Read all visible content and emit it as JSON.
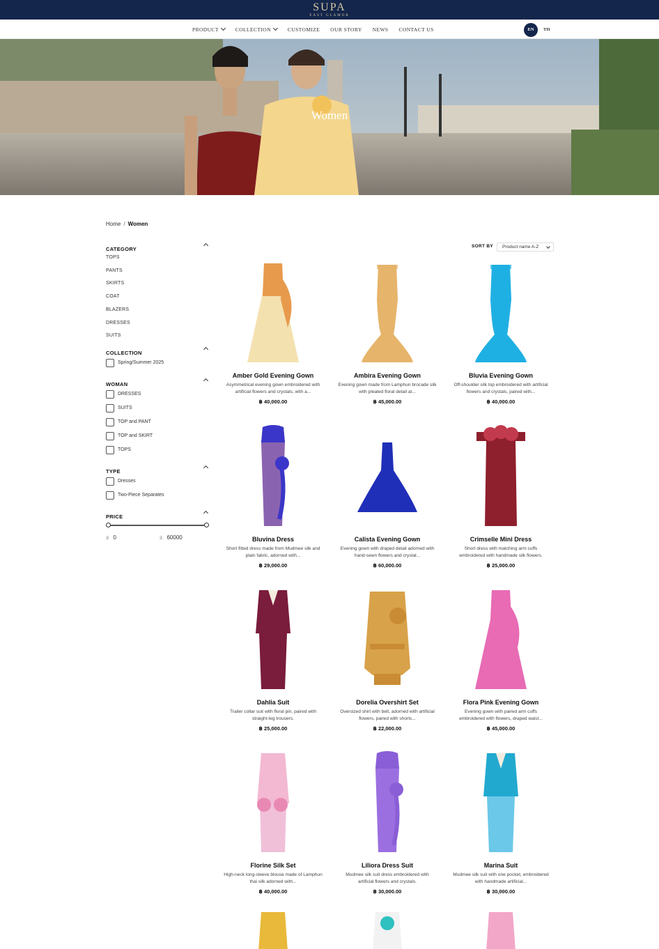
{
  "brand": {
    "name": "SUPA",
    "tagline": "EAST GLAMOR"
  },
  "nav": {
    "items": [
      {
        "label": "PRODUCT",
        "has_dropdown": true
      },
      {
        "label": "COLLECTION",
        "has_dropdown": true
      },
      {
        "label": "CUSTOMIZE",
        "has_dropdown": false
      },
      {
        "label": "OUR STORY",
        "has_dropdown": false
      },
      {
        "label": "NEWS",
        "has_dropdown": false
      },
      {
        "label": "CONTACT US",
        "has_dropdown": false
      }
    ],
    "languages": {
      "active": "EN",
      "other": "TH"
    }
  },
  "hero": {
    "title": "Women"
  },
  "breadcrumb": {
    "home": "Home",
    "separator": "/",
    "current": "Women"
  },
  "filters": {
    "category": {
      "title": "CATEGORY",
      "items": [
        "TOPS",
        "PANTS",
        "SKIRTS",
        "COAT",
        "BLAZERS",
        "DRESSES",
        "SUITS"
      ]
    },
    "collection": {
      "title": "COLLECTION",
      "options": [
        "Spring/Summer 2025"
      ]
    },
    "woman": {
      "title": "WOMAN",
      "options": [
        "DRESSES",
        "SUITS",
        "TOP and PANT",
        "TOP and SKIRT",
        "TOPS"
      ]
    },
    "type": {
      "title": "TYPE",
      "options": [
        "Dresses",
        "Two-Piece Separates"
      ]
    },
    "price": {
      "title": "PRICE",
      "currency": "฿",
      "min": "0",
      "max": "60000"
    }
  },
  "sort": {
    "label": "SORT BY",
    "selected": "Product name A-Z"
  },
  "products": [
    {
      "name": "Amber Gold Evening Gown",
      "desc": "Asymmetrical evening gown embroidered with artificial flowers and crystals, with a...",
      "price": "฿ 40,000.00",
      "colors": [
        "#e89a4c",
        "#f4e1b0"
      ],
      "shape": "gown"
    },
    {
      "name": "Ambira Evening Gown",
      "desc": "Evening gown made from Lamphun brocade silk with pleated floral detail at...",
      "price": "฿ 45,000.00",
      "colors": [
        "#e6b46a",
        "#e6b46a"
      ],
      "shape": "mermaid"
    },
    {
      "name": "Bluvia Evening Gown",
      "desc": "Off-shoulder silk top embroidered with artificial flowers and crystals, paired with...",
      "price": "฿ 40,000.00",
      "colors": [
        "#1fb0e3",
        "#1fb0e3"
      ],
      "shape": "mermaid"
    },
    {
      "name": "Bluvina Dress",
      "desc": "Short fitted dress made from Mudmee silk and plain fabric, adorned with...",
      "price": "฿ 29,000.00",
      "colors": [
        "#3a36c9",
        "#8a63b0"
      ],
      "shape": "sheath"
    },
    {
      "name": "Calista Evening Gown",
      "desc": "Evening gown with draped detail adorned with hand-sewn flowers and crystal...",
      "price": "฿ 60,000.00",
      "colors": [
        "#1f2fb8",
        "#1f2fb8"
      ],
      "shape": "ballgown"
    },
    {
      "name": "Crimselle Mini Dress",
      "desc": "Short dress with matching arm cuffs embroidered with handmade silk flowers.",
      "price": "฿ 25,000.00",
      "colors": [
        "#8e1f2d",
        "#8e1f2d"
      ],
      "shape": "mini"
    },
    {
      "name": "Dahlia Suit",
      "desc": "Trailer collar suit with floral pin, paired with straight-leg trousers.",
      "price": "฿ 25,000.00",
      "colors": [
        "#7a1c3b",
        "#7a1c3b"
      ],
      "shape": "suit"
    },
    {
      "name": "Dorelia Overshirt Set",
      "desc": "Oversized shirt with belt, adorned with artificial flowers, paired with shorts...",
      "price": "฿ 22,000.00",
      "colors": [
        "#d8a24a",
        "#c98c34"
      ],
      "shape": "overshirt"
    },
    {
      "name": "Flora Pink Evening Gown",
      "desc": "Evening gown with paired arm cuffs embroidered with flowers, draped waist...",
      "price": "฿ 45,000.00",
      "colors": [
        "#e86bb4",
        "#e86bb4"
      ],
      "shape": "gown"
    },
    {
      "name": "Florine Silk Set",
      "desc": "High-neck long-sleeve blouse made of Lamphun thai silk adorned with...",
      "price": "฿ 40,000.00",
      "colors": [
        "#f3b8d2",
        "#f0c0d8"
      ],
      "shape": "skirtset"
    },
    {
      "name": "Liliora Dress Suit",
      "desc": "Mudmee silk suit dress embroidered with artificial flowers and crystals.",
      "price": "฿ 30,000.00",
      "colors": [
        "#8a5ed6",
        "#9b6fe0"
      ],
      "shape": "sheath"
    },
    {
      "name": "Marina Suit",
      "desc": "Mudmee silk suit with one pocket, embroidered with handmade artificial...",
      "price": "฿ 30,000.00",
      "colors": [
        "#22a9cf",
        "#6cc8e8"
      ],
      "shape": "suit"
    },
    {
      "name": "",
      "desc": "",
      "price": "",
      "colors": [
        "#e8b93a",
        "#e8b93a"
      ],
      "shape": "partial"
    },
    {
      "name": "",
      "desc": "",
      "price": "",
      "colors": [
        "#f2f2f2",
        "#2fc0c0"
      ],
      "shape": "partial"
    },
    {
      "name": "",
      "desc": "",
      "price": "",
      "colors": [
        "#f2a7c8",
        "#f2a7c8"
      ],
      "shape": "partial"
    }
  ]
}
